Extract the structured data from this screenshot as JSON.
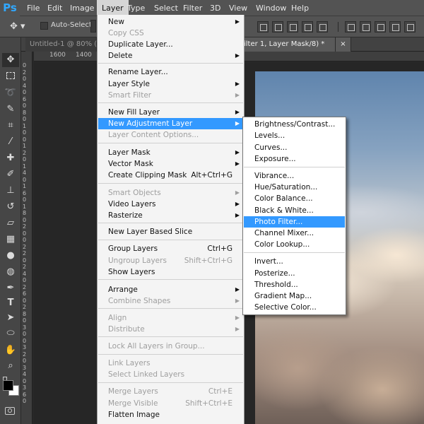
{
  "app": {
    "logo": "Ps"
  },
  "menubar": {
    "items": [
      {
        "label": "File"
      },
      {
        "label": "Edit"
      },
      {
        "label": "Image"
      },
      {
        "label": "Layer"
      },
      {
        "label": "Type"
      },
      {
        "label": "Select"
      },
      {
        "label": "Filter"
      },
      {
        "label": "3D"
      },
      {
        "label": "View"
      },
      {
        "label": "Window"
      },
      {
        "label": "Help"
      }
    ],
    "active": "Layer"
  },
  "options_bar": {
    "auto_select_label": "Auto-Select:"
  },
  "tabs": [
    {
      "label": "Untitled-1 @ 80% (La"
    },
    {
      "label": "ilter 1, Layer Mask/8) *"
    },
    {
      "close": "×"
    }
  ],
  "ruler_top": [
    "1600",
    "1400"
  ],
  "ruler_left": [
    "0",
    "2",
    "0",
    "4",
    "0",
    "6",
    "0",
    "8",
    "0",
    "1",
    "0",
    "0",
    "1",
    "2",
    "0",
    "1",
    "4",
    "0",
    "1",
    "6",
    "0",
    "1",
    "8",
    "0",
    "2",
    "0",
    "0",
    "2",
    "2",
    "0",
    "2",
    "4",
    "0",
    "2",
    "6",
    "0",
    "2",
    "8",
    "0",
    "3",
    "0",
    "0",
    "3",
    "2",
    "0",
    "3",
    "4",
    "0",
    "3",
    "6",
    "0"
  ],
  "layer_menu": {
    "items": [
      {
        "label": "New",
        "submenu": true
      },
      {
        "label": "Copy CSS",
        "disabled": true
      },
      {
        "label": "Duplicate Layer..."
      },
      {
        "label": "Delete",
        "submenu": true
      },
      {
        "label": "Rename Layer..."
      },
      {
        "label": "Layer Style",
        "submenu": true
      },
      {
        "label": "Smart Filter",
        "disabled": true,
        "submenu": true
      },
      {
        "label": "New Fill Layer",
        "submenu": true
      },
      {
        "label": "New Adjustment Layer",
        "submenu": true,
        "highlighted": true
      },
      {
        "label": "Layer Content Options...",
        "disabled": true
      },
      {
        "label": "Layer Mask",
        "submenu": true
      },
      {
        "label": "Vector Mask",
        "submenu": true
      },
      {
        "label": "Create Clipping Mask",
        "shortcut": "Alt+Ctrl+G"
      },
      {
        "label": "Smart Objects",
        "disabled": true,
        "submenu": true
      },
      {
        "label": "Video Layers",
        "submenu": true
      },
      {
        "label": "Rasterize",
        "submenu": true
      },
      {
        "label": "New Layer Based Slice"
      },
      {
        "label": "Group Layers",
        "shortcut": "Ctrl+G"
      },
      {
        "label": "Ungroup Layers",
        "shortcut": "Shift+Ctrl+G",
        "disabled": true
      },
      {
        "label": "Show Layers"
      },
      {
        "label": "Arrange",
        "submenu": true
      },
      {
        "label": "Combine Shapes",
        "disabled": true,
        "submenu": true
      },
      {
        "label": "Align",
        "disabled": true,
        "submenu": true
      },
      {
        "label": "Distribute",
        "disabled": true,
        "submenu": true
      },
      {
        "label": "Lock All Layers in Group...",
        "disabled": true
      },
      {
        "label": "Link Layers",
        "disabled": true
      },
      {
        "label": "Select Linked Layers",
        "disabled": true
      },
      {
        "label": "Merge Layers",
        "shortcut": "Ctrl+E",
        "disabled": true
      },
      {
        "label": "Merge Visible",
        "shortcut": "Shift+Ctrl+E",
        "disabled": true
      },
      {
        "label": "Flatten Image"
      }
    ]
  },
  "adjustment_menu": {
    "items": [
      {
        "label": "Brightness/Contrast..."
      },
      {
        "label": "Levels..."
      },
      {
        "label": "Curves..."
      },
      {
        "label": "Exposure..."
      },
      {
        "label": "Vibrance..."
      },
      {
        "label": "Hue/Saturation..."
      },
      {
        "label": "Color Balance..."
      },
      {
        "label": "Black & White..."
      },
      {
        "label": "Photo Filter...",
        "highlighted": true
      },
      {
        "label": "Channel Mixer..."
      },
      {
        "label": "Color Lookup..."
      },
      {
        "label": "Invert..."
      },
      {
        "label": "Posterize..."
      },
      {
        "label": "Threshold..."
      },
      {
        "label": "Gradient Map..."
      },
      {
        "label": "Selective Color..."
      }
    ]
  },
  "colors": {
    "highlight": "#3399ff",
    "ps_blue": "#31a8ff"
  },
  "tools": [
    "move-icon",
    "marquee-icon",
    "lasso-icon",
    "quick-select-icon",
    "crop-icon",
    "eyedropper-icon",
    "healing-icon",
    "brush-icon",
    "stamp-icon",
    "history-brush-icon",
    "eraser-icon",
    "gradient-icon",
    "blur-icon",
    "dodge-icon",
    "pen-icon",
    "type-icon",
    "path-select-icon",
    "shape-icon",
    "hand-icon",
    "zoom-icon"
  ]
}
